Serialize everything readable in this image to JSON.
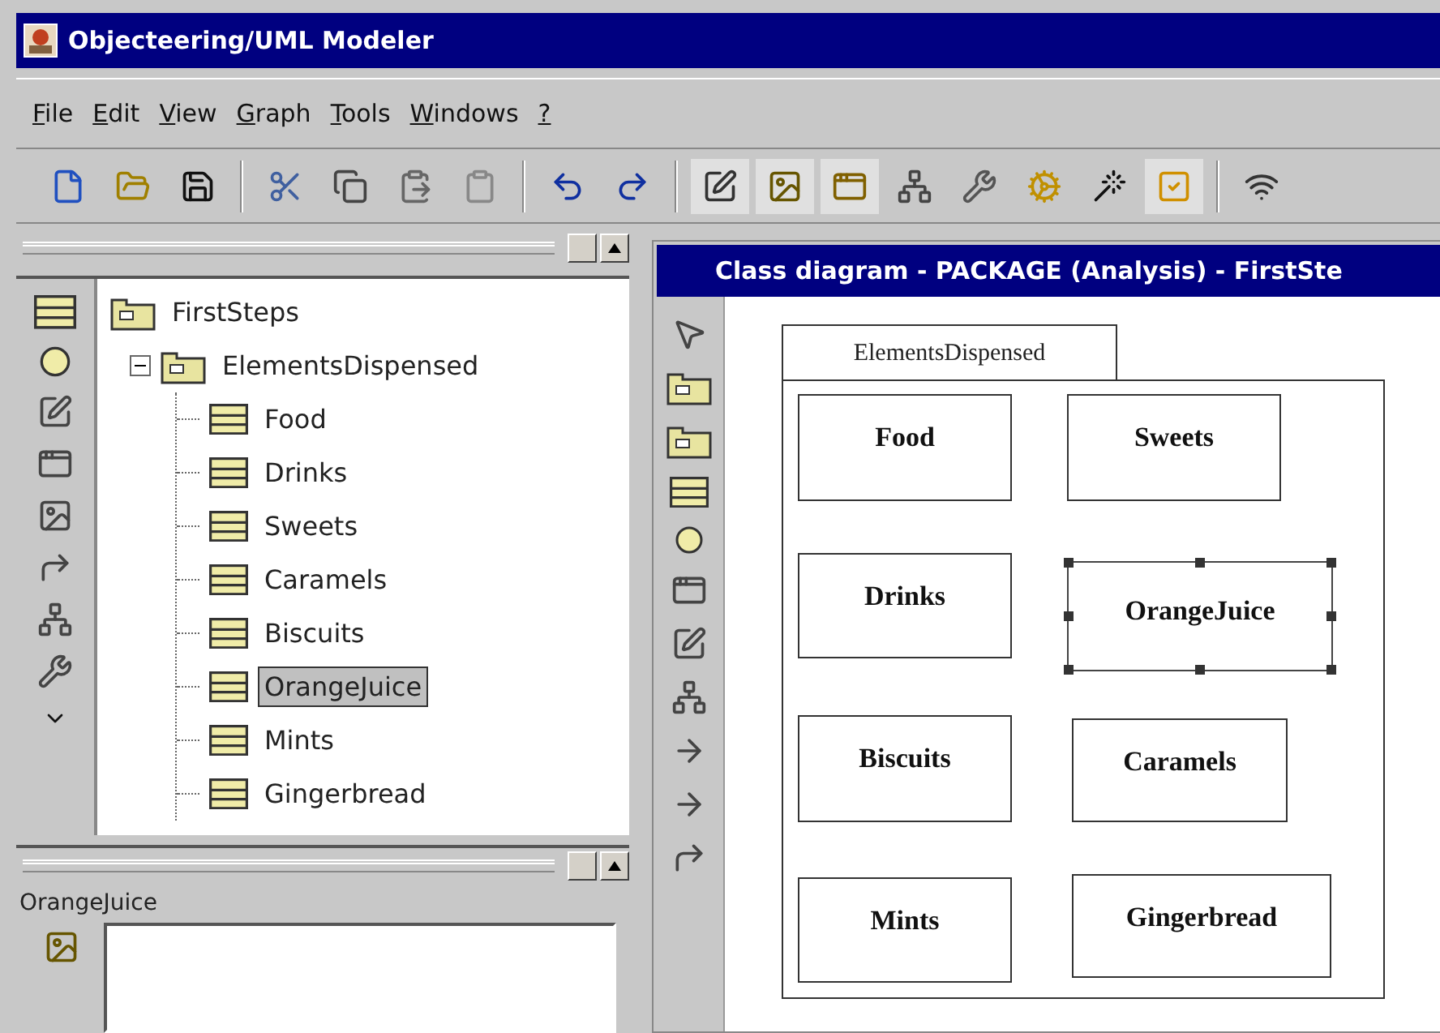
{
  "window": {
    "title": "Objecteering/UML Modeler"
  },
  "menu": [
    "File",
    "Edit",
    "View",
    "Graph",
    "Tools",
    "Windows",
    "?"
  ],
  "toolbar": [
    {
      "kind": "new",
      "pressed": false
    },
    {
      "kind": "open",
      "pressed": false
    },
    {
      "kind": "save",
      "pressed": false
    },
    {
      "kind": "sep"
    },
    {
      "kind": "cut",
      "pressed": false
    },
    {
      "kind": "copy",
      "pressed": false
    },
    {
      "kind": "paste",
      "pressed": false
    },
    {
      "kind": "paste-special",
      "pressed": false
    },
    {
      "kind": "sep"
    },
    {
      "kind": "undo",
      "pressed": false
    },
    {
      "kind": "redo",
      "pressed": false
    },
    {
      "kind": "sep"
    },
    {
      "kind": "edit-diagram",
      "pressed": true
    },
    {
      "kind": "picture",
      "pressed": true
    },
    {
      "kind": "window",
      "pressed": true
    },
    {
      "kind": "hierarchy",
      "pressed": false
    },
    {
      "kind": "wrench",
      "pressed": false
    },
    {
      "kind": "gear",
      "pressed": false
    },
    {
      "kind": "hat",
      "pressed": false
    },
    {
      "kind": "check",
      "pressed": true
    },
    {
      "kind": "sep"
    },
    {
      "kind": "signal",
      "pressed": false
    }
  ],
  "tree": {
    "label": "FirstSteps",
    "children": [
      {
        "label": "ElementsDispensed",
        "expanded": true,
        "children": [
          {
            "label": "Food",
            "selected": false
          },
          {
            "label": "Drinks",
            "selected": false
          },
          {
            "label": "Sweets",
            "selected": false
          },
          {
            "label": "Caramels",
            "selected": false
          },
          {
            "label": "Biscuits",
            "selected": false
          },
          {
            "label": "OrangeJuice",
            "selected": true
          },
          {
            "label": "Mints",
            "selected": false
          },
          {
            "label": "Gingerbread",
            "selected": false
          }
        ]
      }
    ]
  },
  "properties": {
    "title": "OrangeJuice"
  },
  "diagram": {
    "title": "Class diagram - PACKAGE  (Analysis) - FirstSte",
    "package": "ElementsDispensed",
    "classes": [
      {
        "name": "Food",
        "selected": false
      },
      {
        "name": "Sweets",
        "selected": false
      },
      {
        "name": "Drinks",
        "selected": false
      },
      {
        "name": "OrangeJuice",
        "selected": true
      },
      {
        "name": "Biscuits",
        "selected": false
      },
      {
        "name": "Caramels",
        "selected": false
      },
      {
        "name": "Mints",
        "selected": false
      },
      {
        "name": "Gingerbread",
        "selected": false
      }
    ]
  }
}
